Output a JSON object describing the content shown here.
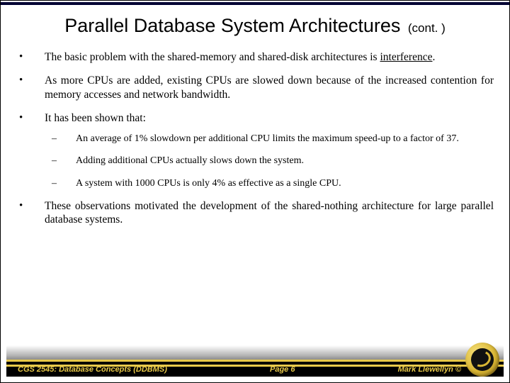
{
  "title": {
    "main": "Parallel Database System Architectures",
    "suffix": "(cont. )"
  },
  "bullets": {
    "b0_pre": "The basic problem with the shared-memory and shared-disk architectures is ",
    "b0_key": "interference",
    "b0_post": ".",
    "b1": "As more CPUs are added, existing CPUs are slowed down because of the increased contention for memory accesses and network bandwidth.",
    "b2": "It has been shown that:",
    "b3": "These observations motivated the development of the shared-nothing architecture for large parallel database systems."
  },
  "sub": {
    "s0": "An average of 1% slowdown per additional CPU limits the maximum speed-up to a factor of 37.",
    "s1": "Adding additional CPUs actually slows down the system.",
    "s2": "A system with 1000 CPUs is only 4% as effective as a single CPU."
  },
  "footer": {
    "left": "CGS 2545: Database Concepts (DDBMS)",
    "center": "Page 6",
    "right": "Mark Llewellyn ©"
  }
}
